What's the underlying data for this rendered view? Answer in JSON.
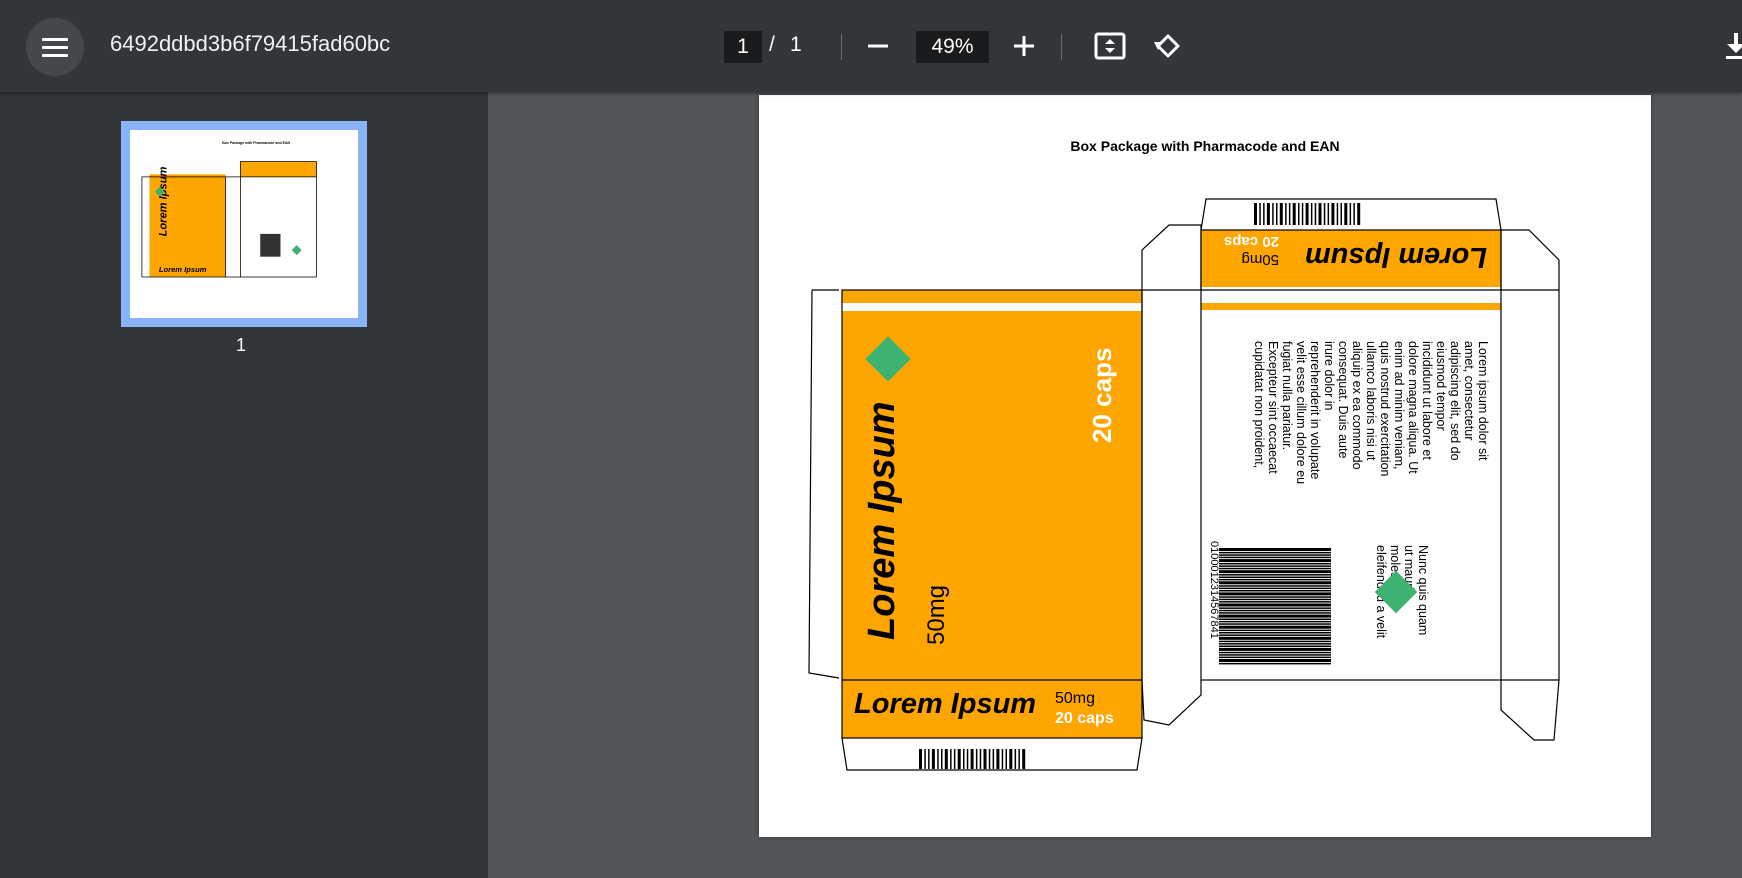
{
  "viewer": {
    "file_name": "6492ddbd3b6f79415fad60bc",
    "current_page": "1",
    "page_separator": "/",
    "total_pages": "1",
    "zoom": "49%",
    "thumbnail_label": "1"
  },
  "document": {
    "title": "Box Package with Pharmacode and EAN",
    "brand": "Lorem Ipsum",
    "dose": "50mg",
    "count": "20 caps",
    "body_text": [
      "Lorem ipsum dolor sit",
      "amet, consectetur",
      "adipiscing elit, sed do",
      "eiusmod tempor",
      "incididunt ut labore et",
      "dolore magna aliqua. Ut",
      "enim ad minim veniam,",
      "quis nostrud exercitation",
      "ullamco laboris nisi ut",
      "aliquip ex ea commodo",
      "consequat. Duis aute",
      "irure dolor in",
      "reprehenderit in volupate",
      "velit esse cillum dolore eu",
      "fugiat nulla pariatur.",
      "Excepteur sint occaecat",
      "cupidatat non proident,"
    ],
    "side_text": [
      "Nunc quis quam",
      "ut mauris",
      "molestie",
      "eleifend id a velit"
    ],
    "ean_number": "0100012314567841"
  },
  "colors": {
    "brand_orange": "#FFA500",
    "diamond_green": "#3CB371",
    "toolbar_bg": "#323639",
    "viewer_bg": "#525659",
    "thumb_highlight": "#8AB4F8"
  },
  "icons": {
    "menu": "hamburger-menu-icon",
    "zoom_out": "minus-icon",
    "zoom_in": "plus-icon",
    "fit_page": "fit-to-page-icon",
    "rotate": "rotate-counterclockwise-icon",
    "download": "download-icon"
  }
}
